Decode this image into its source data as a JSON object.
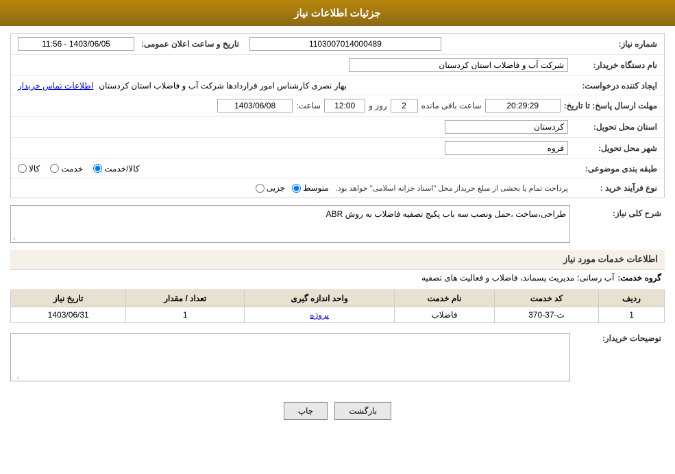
{
  "page": {
    "title": "جزئیات اطلاعات نیاز"
  },
  "header": {
    "title": "جزئیات اطلاعات نیاز"
  },
  "fields": {
    "need_number_label": "شماره نیاز:",
    "need_number_value": "1103007014000489",
    "announce_label": "تاریخ و ساعت اعلان عمومی:",
    "announce_value": "1403/06/05 - 11:56",
    "buyer_org_label": "نام دستگاه خریدار:",
    "buyer_org_value": "شرکت آب و فاضلاب استان کردستان",
    "creator_label": "ایجاد کننده درخواست:",
    "creator_value": "بهار نصری کارشناس امور قراردادها شرکت آب و فاضلاب استان کردستان",
    "creator_link": "اطلاعات تماس خریدار",
    "deadline_label": "مهلت ارسال پاسخ: تا تاریخ:",
    "deadline_date": "1403/06/08",
    "deadline_time_label": "ساعت:",
    "deadline_time": "12:00",
    "deadline_day_label": "روز و",
    "deadline_days": "2",
    "deadline_remaining_label": "ساعت باقی مانده",
    "deadline_remaining": "20:29:29",
    "province_label": "استان محل تحویل:",
    "province_value": "کردستان",
    "city_label": "شهر محل تحویل:",
    "city_value": "فروه",
    "category_label": "طبقه بندی موضوعی:",
    "category_options": [
      "کالا",
      "خدمت",
      "کالا/خدمت"
    ],
    "category_selected": "کالا/خدمت",
    "purchase_type_label": "نوع فرآیند خرید :",
    "purchase_types": [
      "جزیی",
      "متوسط"
    ],
    "purchase_type_selected": "متوسط",
    "purchase_desc": "پرداخت تمام یا بخشی از مبلغ خریداز محل \"اسناد خزانه اسلامی\" خواهد بود.",
    "need_desc_label": "شرح کلی نیاز:",
    "need_desc_value": "طراحی،ساخت ،حمل ونصب سه باب پکیج تصفیه فاضلاب به روش ABR",
    "services_section_label": "اطلاعات خدمات مورد نیاز",
    "service_group_label": "گروه خدمت:",
    "service_group_value": "آب رسانی؛ مدیریت پسماند، فاضلاب و فعالیت های تصفیه",
    "table_headers": [
      "ردیف",
      "کد خدمت",
      "نام خدمت",
      "واحد اندازه گیری",
      "تعداد / مقدار",
      "تاریخ نیاز"
    ],
    "table_rows": [
      {
        "row": "1",
        "service_code": "ث-37-370",
        "service_name": "فاضلاب",
        "unit": "پروژه",
        "quantity": "1",
        "date": "1403/06/31"
      }
    ],
    "buyer_desc_label": "توضیحات خریدار:",
    "buyer_desc_value": ""
  },
  "buttons": {
    "print": "چاپ",
    "back": "بازگشت"
  }
}
